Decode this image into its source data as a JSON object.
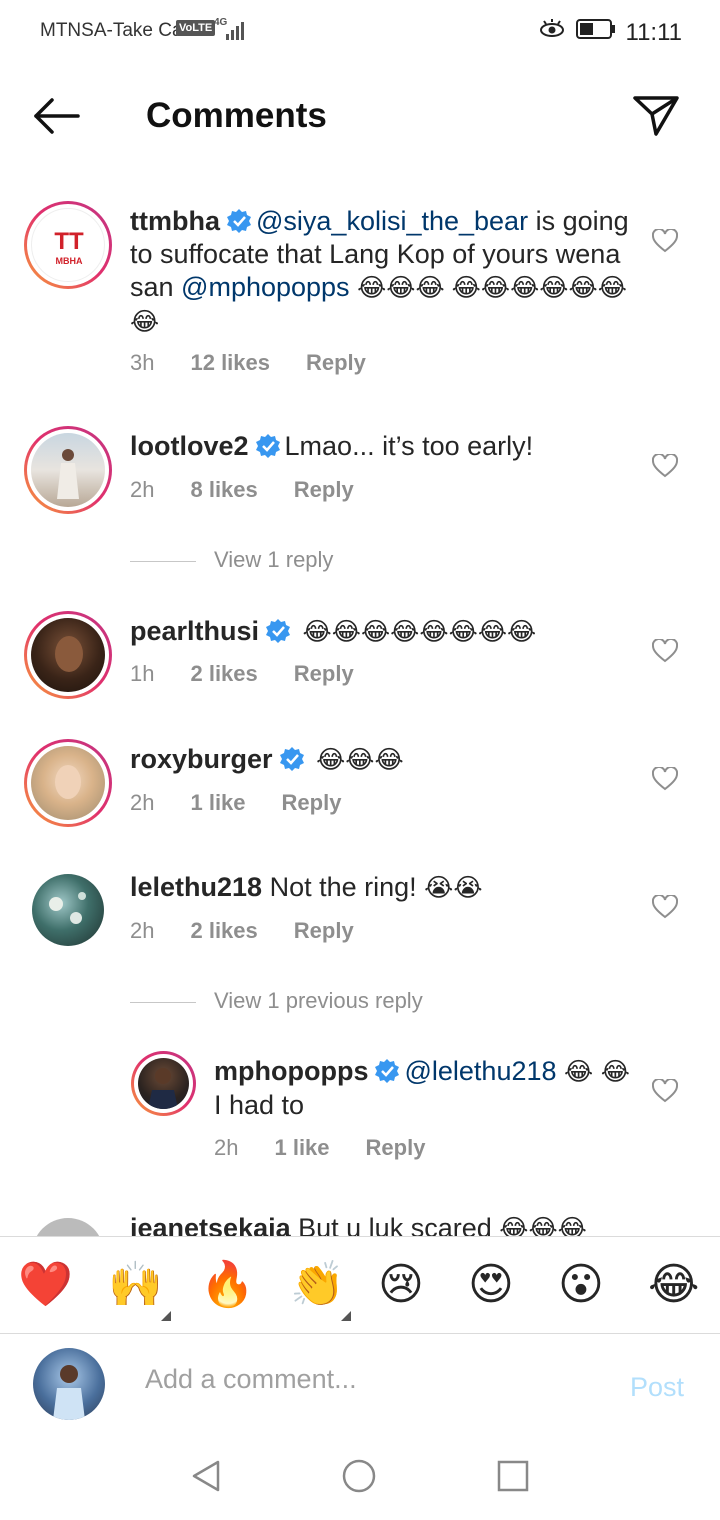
{
  "status_bar": {
    "carrier": "MTNSA-Take Ca",
    "volte": "VoLTE",
    "network": "4G",
    "time": "11:11"
  },
  "header": {
    "title": "Comments"
  },
  "comments": [
    {
      "username": "ttmbha",
      "mention1": "@siya_kolisi_the_bear",
      "text1": " is going to suffocate that Lang Kop of yours wena san ",
      "mention2": "@mphopopps",
      "emojis": "😂😂😂 😂😂😂😂😂😂😂",
      "time": "3h",
      "likes": "12 likes",
      "reply": "Reply",
      "avatar_text": "TT",
      "avatar_sub": "MBHA"
    },
    {
      "username": "lootlove2",
      "text": "Lmao... it’s too early!",
      "time": "2h",
      "likes": "8 likes",
      "reply": "Reply",
      "view_replies": "View 1 reply"
    },
    {
      "username": "pearlthusi",
      "emojis": "😂😂😂😂😂😂😂😂",
      "time": "1h",
      "likes": "2 likes",
      "reply": "Reply"
    },
    {
      "username": "roxyburger",
      "emojis": "😂😂😂",
      "time": "2h",
      "likes": "1 like",
      "reply": "Reply"
    },
    {
      "username": "lelethu218",
      "text": "Not the ring! ",
      "emojis": "😭😭",
      "time": "2h",
      "likes": "2 likes",
      "reply": "Reply",
      "view_replies": "View 1 previous reply"
    },
    {
      "username": "mphopopps",
      "mention": "@lelethu218",
      "emoji1": "😂",
      "emoji2": "😂",
      "text": " I had to",
      "time": "2h",
      "likes": "1 like",
      "reply": "Reply"
    },
    {
      "username": "jeanetsekaia",
      "text": "But u luk scared ",
      "emojis": "😂😂😂"
    }
  ],
  "emoji_bar": [
    "❤️",
    "🙌",
    "🔥",
    "👏",
    "😢",
    "😍",
    "😮",
    "😂"
  ],
  "composer": {
    "placeholder": "Add a comment...",
    "post_label": "Post"
  },
  "colors": {
    "accent_blue": "#0095f6",
    "post_disabled": "#b2dffc",
    "verified": "#3897f0",
    "mention": "#00376b"
  }
}
